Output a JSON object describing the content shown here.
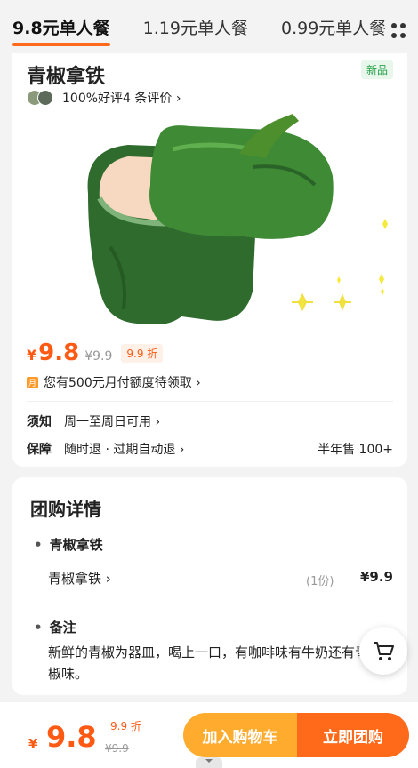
{
  "tabs": [
    {
      "label": "9.8元单人餐",
      "active": true
    },
    {
      "label": "1.19元单人餐",
      "active": false
    },
    {
      "label": "0.99元单人餐",
      "active": false
    }
  ],
  "product": {
    "title": "青椒拿铁",
    "badge": "新品",
    "rating_text": "100%好评4 条评价 ›",
    "price_symbol": "¥",
    "price": "9.8",
    "original_price": "¥9.9",
    "discount": "9.9 折",
    "credit_text": "您有500元月付额度待领取 ›",
    "notice_key": "须知",
    "notice_val": "周一至周日可用 ›",
    "guarantee_key": "保障",
    "guarantee_val": "随时退 · 过期自动退 ›",
    "sold": "半年售 100+"
  },
  "details": {
    "title": "团购详情",
    "group_label": "青椒拿铁",
    "item_name": "青椒拿铁 ›",
    "item_qty": "(1份)",
    "item_price": "¥9.9",
    "note_label": "备注",
    "note_text": "新鲜的青椒为器皿，喝上一口，有咖啡味有牛奶还有青椒味。"
  },
  "bottom_bar": {
    "price_symbol": "¥",
    "price": "9.8",
    "discount": "9.9 折",
    "original_price": "¥9.9",
    "add_to_cart": "加入购物车",
    "buy_now": "立即团购"
  },
  "colors": {
    "accent": "#ff6a1a",
    "cart_button": "#ffab2e",
    "new_badge": "#2aa24a"
  },
  "icons": [
    "more-icon",
    "chevron-right-icon",
    "credit-icon",
    "cart-icon",
    "sparkle-icon"
  ]
}
